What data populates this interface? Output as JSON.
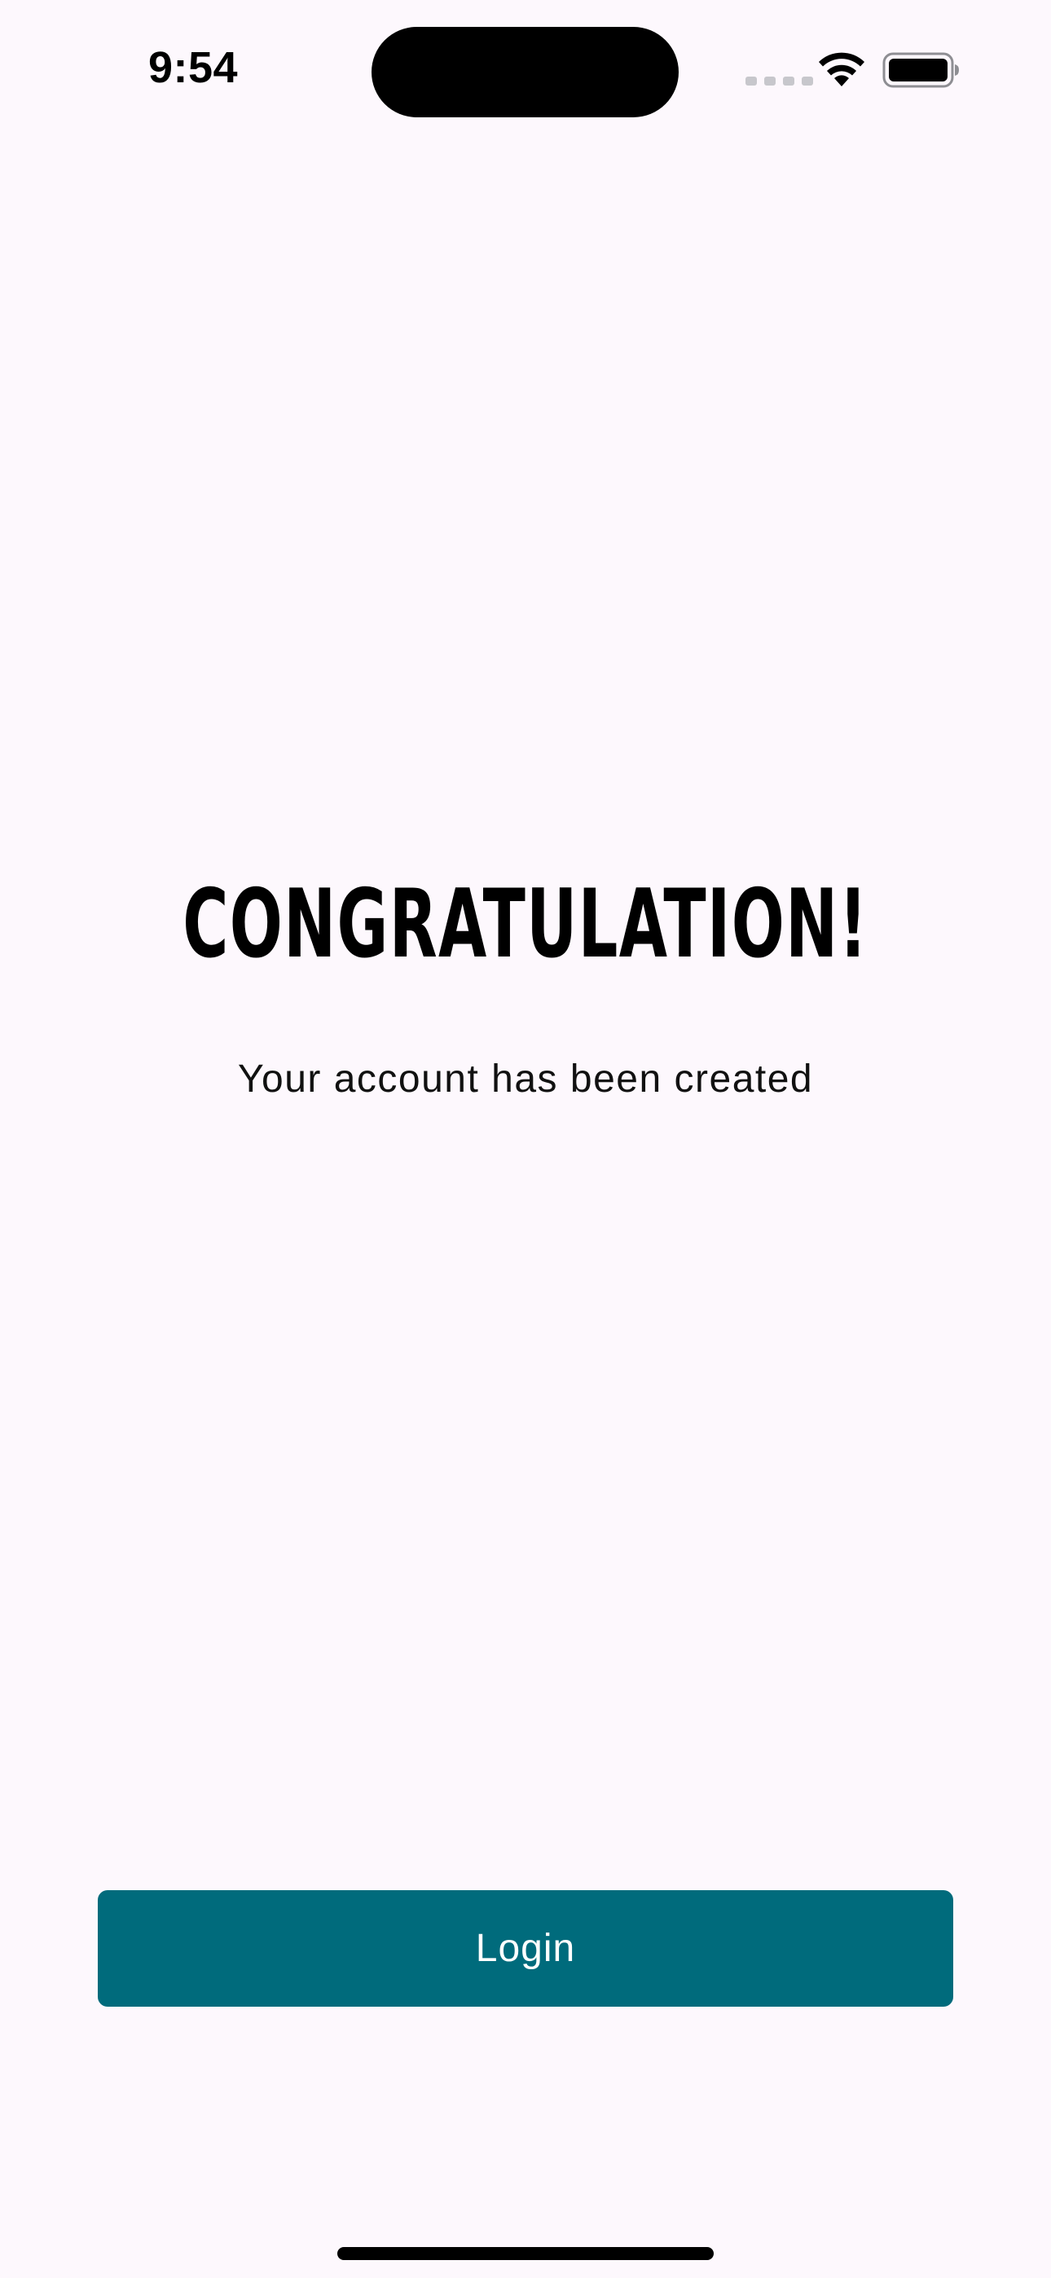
{
  "status_bar": {
    "time": "9:54",
    "icons": [
      "signal-dots-icon",
      "wifi-icon",
      "battery-icon"
    ]
  },
  "main": {
    "headline": "CONGRATULATION!",
    "subtitle": "Your account has been created"
  },
  "actions": {
    "login_label": "Login"
  },
  "colors": {
    "background": "#fdf8fd",
    "button": "#006b7c",
    "button_text": "#ffffff",
    "text": "#000000"
  }
}
